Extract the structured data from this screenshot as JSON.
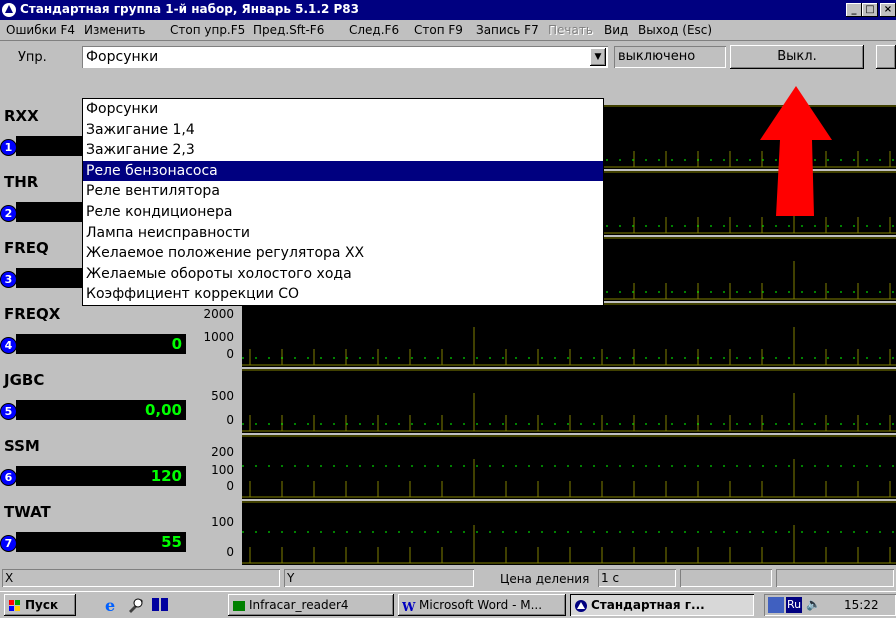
{
  "window": {
    "title": "Стандартная группа 1-й набор, Январь 5.1.2 Р83",
    "minimize": "_",
    "maximize": "□",
    "close": "×"
  },
  "menu": {
    "items": [
      {
        "label": "Ошибки F4",
        "disabled": false
      },
      {
        "label": "Изменить",
        "disabled": false
      },
      {
        "label": "Стоп упр.F5",
        "disabled": false
      },
      {
        "label": "Пред.Sft-F6",
        "disabled": false
      },
      {
        "label": "След.F6",
        "disabled": false
      },
      {
        "label": "Стоп F9",
        "disabled": false
      },
      {
        "label": "Запись F7",
        "disabled": false
      },
      {
        "label": "Печать",
        "disabled": true
      },
      {
        "label": "Вид",
        "disabled": false
      },
      {
        "label": "Выход (Esc)",
        "disabled": false
      }
    ]
  },
  "control": {
    "label": "Упр.",
    "selected_value": "Форсунки",
    "state": "выключено",
    "toggle_button": "Выкл."
  },
  "dropdown": {
    "options": [
      "Форсунки",
      "Зажигание 1,4",
      "Зажигание 2,3",
      "Реле бензонасоса",
      "Реле вентилятора",
      "Реле кондиционера",
      "Лампа неисправности",
      "Желаемое положение регулятора ХХ",
      "Желаемые обороты холостого хода",
      "Коэффициент коррекции СО"
    ],
    "highlighted_index": 3
  },
  "channels": [
    {
      "name": "RXX",
      "num": "1",
      "value": "",
      "scale_top": "",
      "scale_mid": "",
      "scale_bottom": ""
    },
    {
      "name": "THR",
      "num": "2",
      "value": "",
      "scale_top": "",
      "scale_mid": "",
      "scale_bottom": ""
    },
    {
      "name": "FREQ",
      "num": "3",
      "value": "",
      "scale_top": "",
      "scale_mid": "",
      "scale_bottom": ""
    },
    {
      "name": "FREQX",
      "num": "4",
      "value": "0",
      "scale_top": "2000",
      "scale_mid": "1000",
      "scale_bottom": "0"
    },
    {
      "name": "JGBC",
      "num": "5",
      "value": "0,00",
      "scale_top": "500",
      "scale_mid": "",
      "scale_bottom": "0"
    },
    {
      "name": "SSM",
      "num": "6",
      "value": "120",
      "scale_top": "200",
      "scale_mid": "100",
      "scale_bottom": "0"
    },
    {
      "name": "TWAT",
      "num": "7",
      "value": "55",
      "scale_top": "100",
      "scale_mid": "",
      "scale_bottom": "0"
    }
  ],
  "statusbar": {
    "x_label": "X",
    "y_label": "Y",
    "division_label": "Цена деления",
    "division_value": "1 с"
  },
  "taskbar": {
    "start": "Пуск",
    "buttons": [
      "Infracar_reader4",
      "Microsoft Word - M...",
      "Стандартная г..."
    ],
    "active_index": 2,
    "tray_lang": "Ru",
    "clock": "15:22"
  },
  "colors": {
    "title_bg": "#000080",
    "plot_bg": "#000000",
    "trace": "#00ff00",
    "grid": "#808000",
    "arrow": "#ff0000"
  }
}
